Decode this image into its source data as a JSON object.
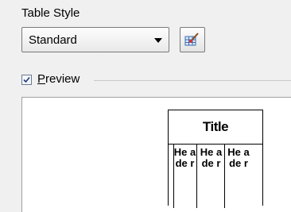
{
  "table_style": {
    "label": "Table Style",
    "selected": "Standard",
    "edit_button_icon": "table-style-brush-icon"
  },
  "preview": {
    "checkbox_checked": true,
    "label_underlined": "P",
    "label_rest": "review",
    "sample": {
      "title": "Title",
      "headers": [
        "He ade r",
        "He ade r",
        "He ade r"
      ]
    }
  }
}
